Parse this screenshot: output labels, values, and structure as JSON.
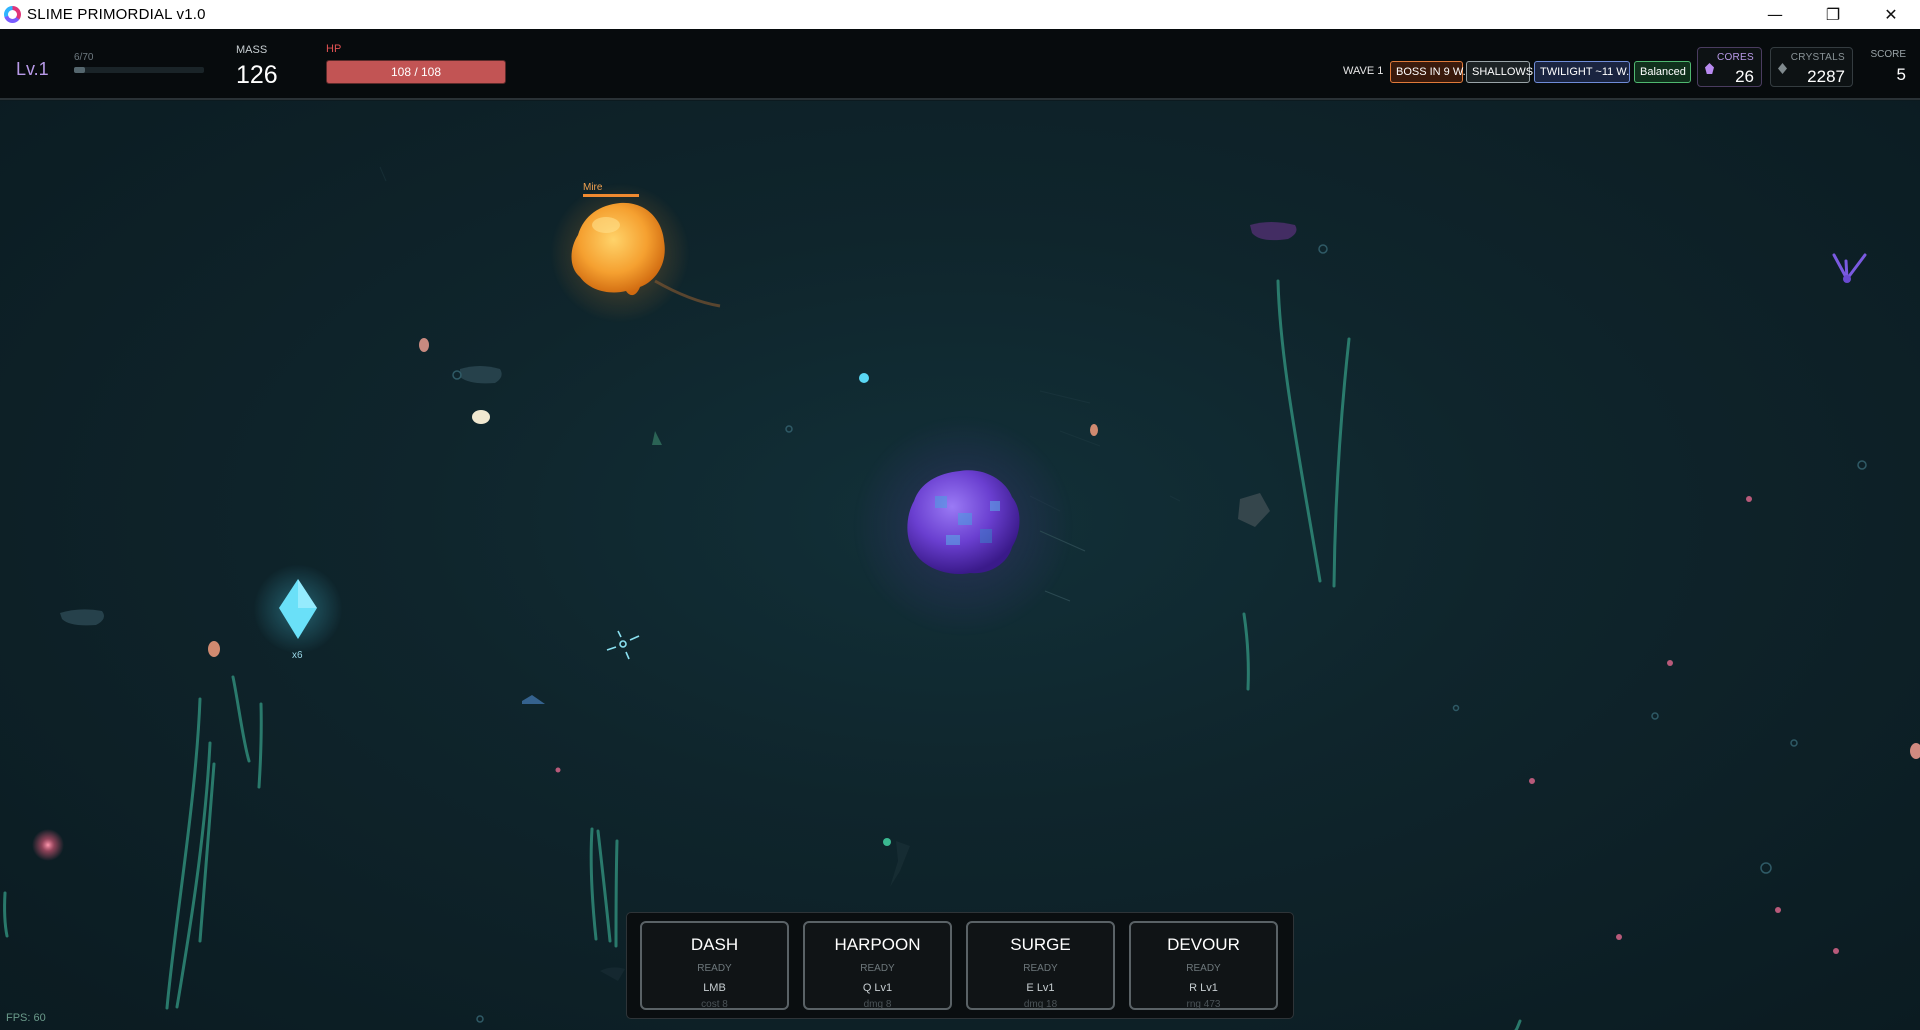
{
  "window": {
    "title": "SLIME PRIMORDIAL  v1.0",
    "controls": [
      "minimize-icon",
      "restore-icon",
      "close-icon"
    ]
  },
  "hud": {
    "level": "Lv.1",
    "xp": {
      "text": "6/70",
      "fraction": 0.086
    },
    "mass": {
      "label": "MASS",
      "value": "126"
    },
    "hp": {
      "label": "HP",
      "text": "108 / 108",
      "fraction": 1.0
    },
    "wave": "WAVE 1",
    "badges": {
      "boss": "BOSS IN 9 W.",
      "zone": "SHALLOWS",
      "time": "TWILIGHT ~11 W.",
      "mode": "Balanced"
    },
    "cores": {
      "label": "CORES",
      "value": "26"
    },
    "crystals": {
      "label": "CRYSTALS",
      "value": "2287"
    },
    "score": {
      "label": "SCORE",
      "value": "5"
    }
  },
  "world": {
    "boss_name": "Mire",
    "crystal_pickup_count": "x6",
    "fps": "FPS: 60"
  },
  "abilities": [
    {
      "name": "DASH",
      "status": "READY",
      "key": "LMB",
      "stat": "cost 8"
    },
    {
      "name": "HARPOON",
      "status": "READY",
      "key": "Q Lv1",
      "stat": "dmg 8"
    },
    {
      "name": "SURGE",
      "status": "READY",
      "key": "E Lv1",
      "stat": "dmg 18"
    },
    {
      "name": "DEVOUR",
      "status": "READY",
      "key": "R Lv1",
      "stat": "rng 473"
    }
  ],
  "colors": {
    "player": "#7a4fe0",
    "boss": "#f5a030",
    "crystal": "#4fd8f5",
    "hp_fill": "#c25454",
    "seaweed": "#2f8a78"
  }
}
